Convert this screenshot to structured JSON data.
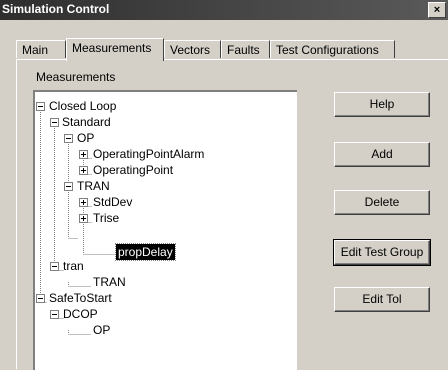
{
  "window": {
    "title": "Simulation Control",
    "close_label": "×"
  },
  "tabs": [
    {
      "label": "Main"
    },
    {
      "label": "Measurements"
    },
    {
      "label": "Vectors"
    },
    {
      "label": "Faults"
    },
    {
      "label": "Test Configurations"
    }
  ],
  "active_tab": "Measurements",
  "group_label": "Measurements",
  "tree": {
    "nodes": [
      {
        "label": "Closed Loop",
        "state": "expanded"
      },
      {
        "label": "Standard",
        "state": "expanded"
      },
      {
        "label": "OP",
        "state": "expanded"
      },
      {
        "label": "OperatingPointAlarm",
        "state": "collapsed"
      },
      {
        "label": "OperatingPoint",
        "state": "collapsed"
      },
      {
        "label": "TRAN",
        "state": "expanded"
      },
      {
        "label": "StdDev",
        "state": "collapsed"
      },
      {
        "label": "Trise",
        "state": "collapsed"
      },
      {
        "label": "propDelay",
        "state": "leaf",
        "selected": true
      },
      {
        "label": "tran",
        "state": "expanded"
      },
      {
        "label": "TRAN",
        "state": "leaf"
      },
      {
        "label": "SafeToStart",
        "state": "expanded"
      },
      {
        "label": "DCOP",
        "state": "expanded"
      },
      {
        "label": "OP",
        "state": "leaf"
      }
    ]
  },
  "buttons": {
    "help": "Help",
    "add": "Add",
    "delete": "Delete",
    "edit_test_group": "Edit Test Group",
    "edit_tol": "Edit Tol"
  }
}
